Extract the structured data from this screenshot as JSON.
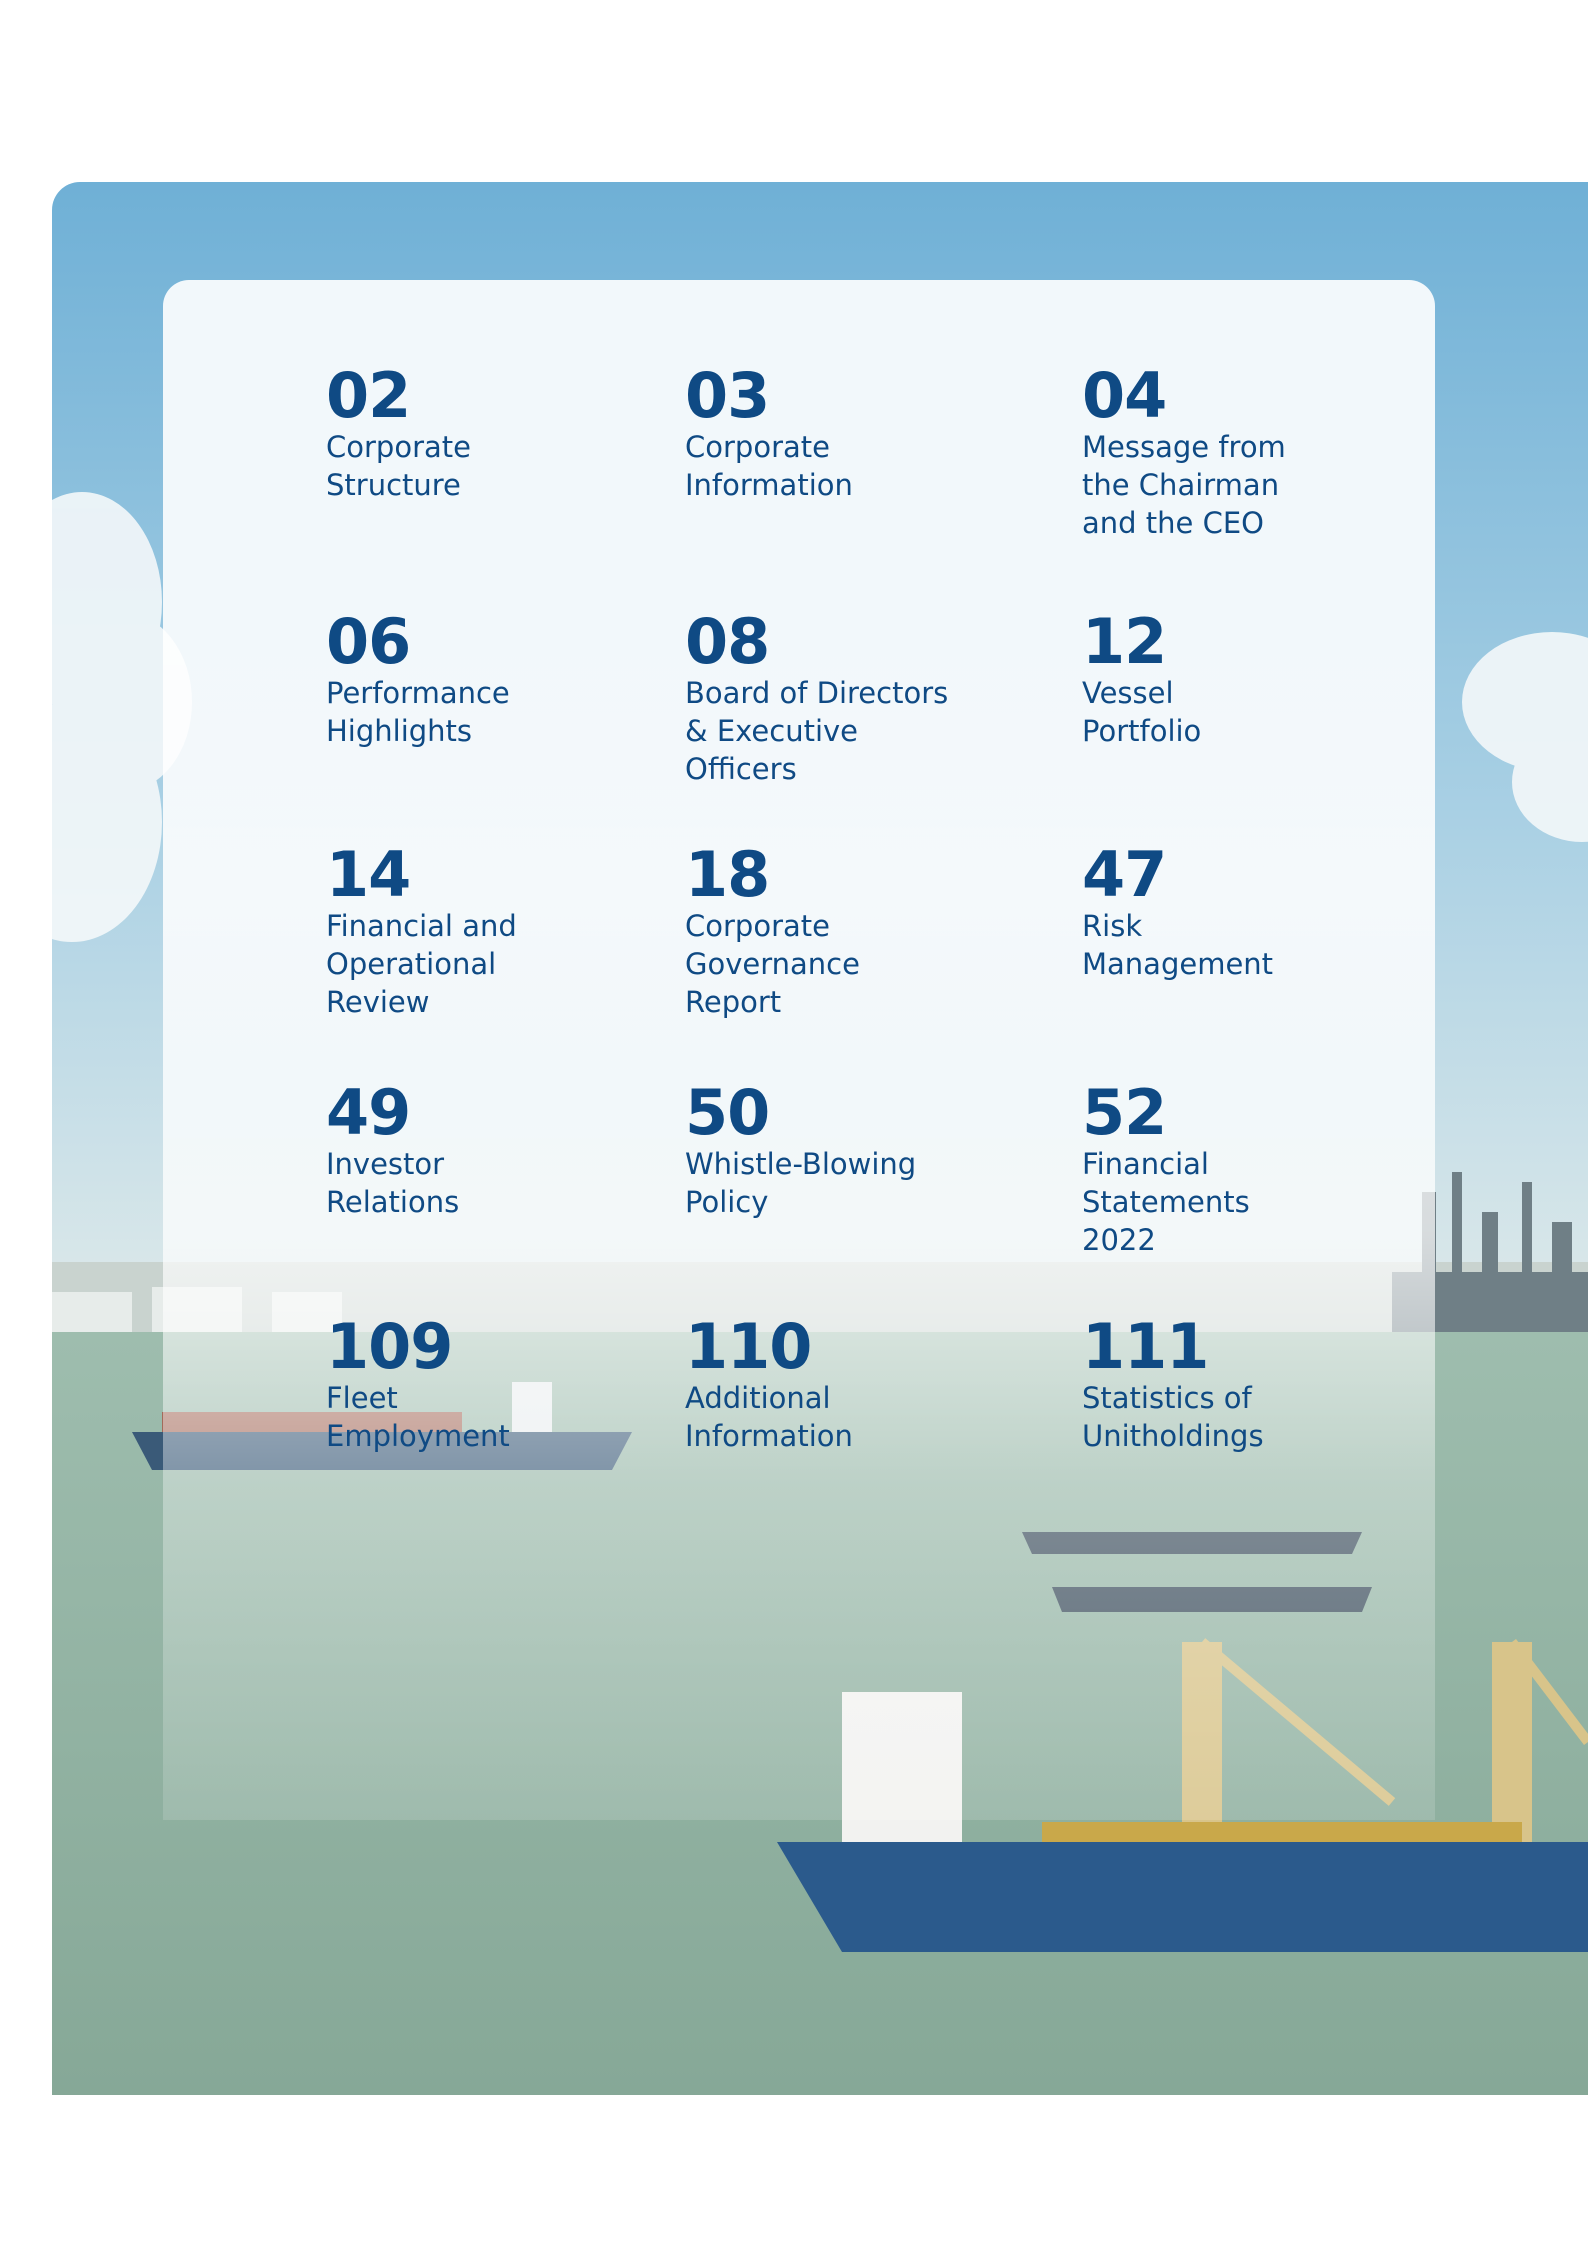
{
  "contents": [
    {
      "number": "02",
      "title": "Corporate\nStructure"
    },
    {
      "number": "03",
      "title": "Corporate\nInformation"
    },
    {
      "number": "04",
      "title": "Message from\nthe Chairman\nand the CEO"
    },
    {
      "number": "06",
      "title": "Performance\nHighlights"
    },
    {
      "number": "08",
      "title": "Board of Directors\n& Executive\nOfficers"
    },
    {
      "number": "12",
      "title": "Vessel\nPortfolio"
    },
    {
      "number": "14",
      "title": "Financial and\nOperational\nReview"
    },
    {
      "number": "18",
      "title": "Corporate\nGovernance\nReport"
    },
    {
      "number": "47",
      "title": "Risk\nManagement"
    },
    {
      "number": "49",
      "title": "Investor\nRelations"
    },
    {
      "number": "50",
      "title": "Whistle-Blowing\nPolicy"
    },
    {
      "number": "52",
      "title": "Financial\nStatements\n2022"
    },
    {
      "number": "109",
      "title": "Fleet\nEmployment"
    },
    {
      "number": "110",
      "title": "Additional\nInformation"
    },
    {
      "number": "111",
      "title": "Statistics of\nUnitholdings"
    }
  ],
  "colors": {
    "text": "#0f4a84",
    "sky": "#7fb8d8",
    "sea": "#8fb0a2",
    "hull": "#2b5a8c",
    "crane": "#d8c48a"
  }
}
